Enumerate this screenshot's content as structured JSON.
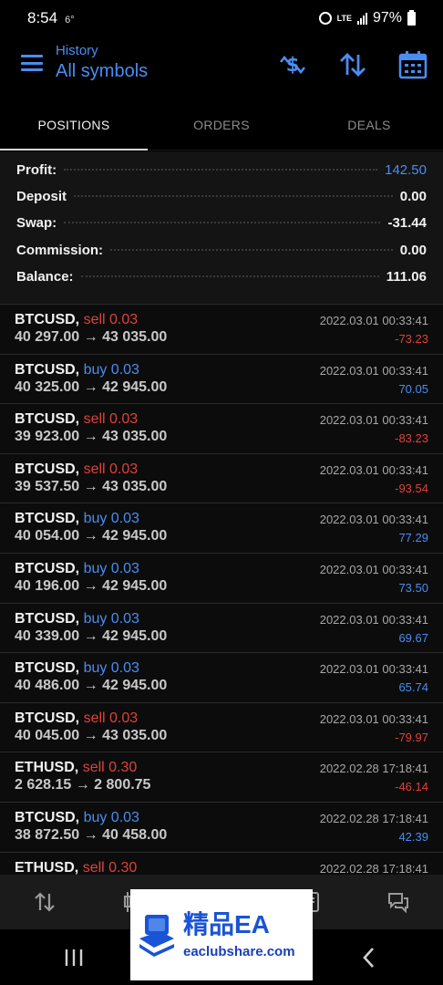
{
  "status": {
    "time": "8:54",
    "temp": "6°",
    "network": "LTE",
    "battery": "97%"
  },
  "header": {
    "subtitle": "History",
    "title": "All symbols"
  },
  "tabs": [
    {
      "label": "POSITIONS"
    },
    {
      "label": "ORDERS"
    },
    {
      "label": "DEALS"
    }
  ],
  "summary": [
    {
      "label": "Profit:",
      "value": "142.50"
    },
    {
      "label": "Deposit",
      "value": "0.00"
    },
    {
      "label": "Swap:",
      "value": "-31.44"
    },
    {
      "label": "Commission:",
      "value": "0.00"
    },
    {
      "label": "Balance:",
      "value": "111.06"
    }
  ],
  "deals": [
    {
      "symbol": "BTCUSD,",
      "side": "sell 0.03",
      "prices": "40 297.00 → 43 035.00",
      "time": "2022.03.01 00:33:41",
      "profit": "-73.23"
    },
    {
      "symbol": "BTCUSD,",
      "side": "buy 0.03",
      "prices": "40 325.00 → 42 945.00",
      "time": "2022.03.01 00:33:41",
      "profit": "70.05"
    },
    {
      "symbol": "BTCUSD,",
      "side": "sell 0.03",
      "prices": "39 923.00 → 43 035.00",
      "time": "2022.03.01 00:33:41",
      "profit": "-83.23"
    },
    {
      "symbol": "BTCUSD,",
      "side": "sell 0.03",
      "prices": "39 537.50 → 43 035.00",
      "time": "2022.03.01 00:33:41",
      "profit": "-93.54"
    },
    {
      "symbol": "BTCUSD,",
      "side": "buy 0.03",
      "prices": "40 054.00 → 42 945.00",
      "time": "2022.03.01 00:33:41",
      "profit": "77.29"
    },
    {
      "symbol": "BTCUSD,",
      "side": "buy 0.03",
      "prices": "40 196.00 → 42 945.00",
      "time": "2022.03.01 00:33:41",
      "profit": "73.50"
    },
    {
      "symbol": "BTCUSD,",
      "side": "buy 0.03",
      "prices": "40 339.00 → 42 945.00",
      "time": "2022.03.01 00:33:41",
      "profit": "69.67"
    },
    {
      "symbol": "BTCUSD,",
      "side": "buy 0.03",
      "prices": "40 486.00 → 42 945.00",
      "time": "2022.03.01 00:33:41",
      "profit": "65.74"
    },
    {
      "symbol": "BTCUSD,",
      "side": "sell 0.03",
      "prices": "40 045.00 → 43 035.00",
      "time": "2022.03.01 00:33:41",
      "profit": "-79.97"
    },
    {
      "symbol": "ETHUSD,",
      "side": "sell 0.30",
      "prices": "2 628.15 → 2 800.75",
      "time": "2022.02.28 17:18:41",
      "profit": "-46.14"
    },
    {
      "symbol": "BTCUSD,",
      "side": "buy 0.03",
      "prices": "38 872.50 → 40 458.00",
      "time": "2022.02.28 17:18:41",
      "profit": "42.39"
    },
    {
      "symbol": "ETHUSD,",
      "side": "sell 0.30",
      "prices": "",
      "time": "2022.02.28 17:18:41",
      "profit": ""
    }
  ],
  "watermark": {
    "brand": "精品EA",
    "url": "eaclubshare.com"
  },
  "colors": {
    "accent": "#4a8df0",
    "loss": "#e0413a",
    "background": "#000000"
  }
}
